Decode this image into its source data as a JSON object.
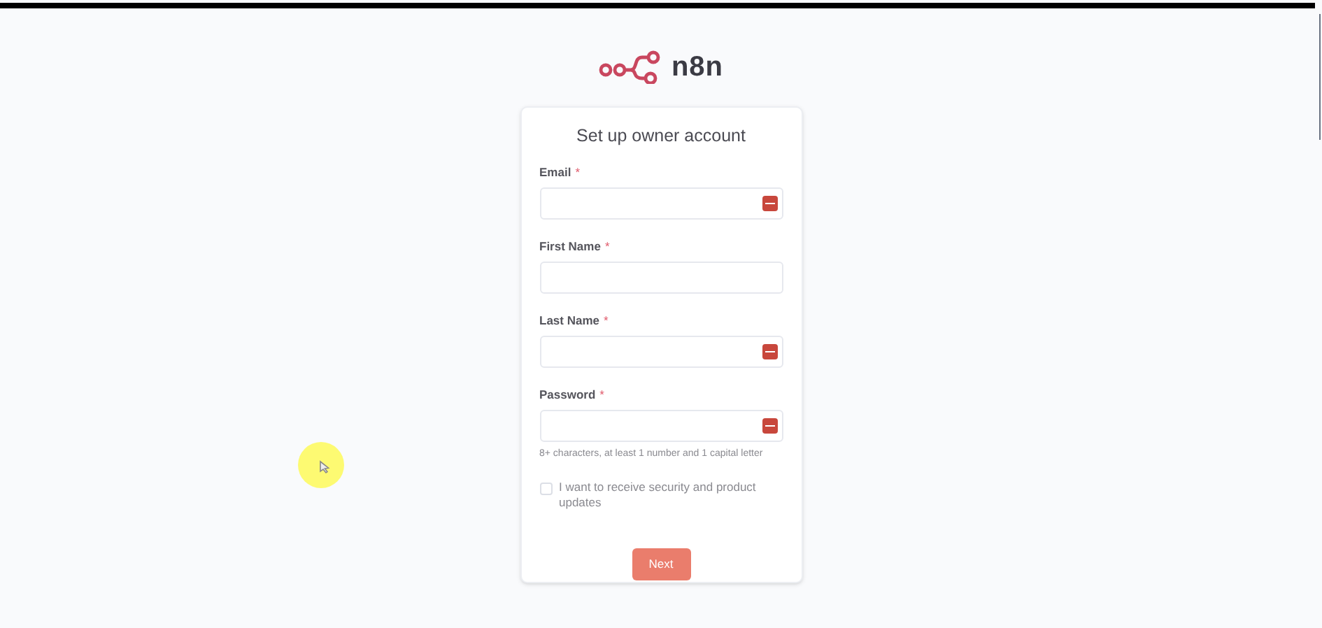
{
  "logo": {
    "text": "n8n"
  },
  "card": {
    "title": "Set up owner account"
  },
  "fields": [
    {
      "label": "Email",
      "required_mark": "*",
      "autofill_icon": true
    },
    {
      "label": "First Name",
      "required_mark": "*",
      "autofill_icon": false
    },
    {
      "label": "Last Name",
      "required_mark": "*",
      "autofill_icon": true
    },
    {
      "label": "Password",
      "required_mark": "*",
      "autofill_icon": true,
      "hint": "8+ characters, at least 1 number and 1 capital letter"
    }
  ],
  "checkbox": {
    "label": "I want to receive security and product updates",
    "checked": false
  },
  "next_button": {
    "label": "Next",
    "disabled": true
  }
}
